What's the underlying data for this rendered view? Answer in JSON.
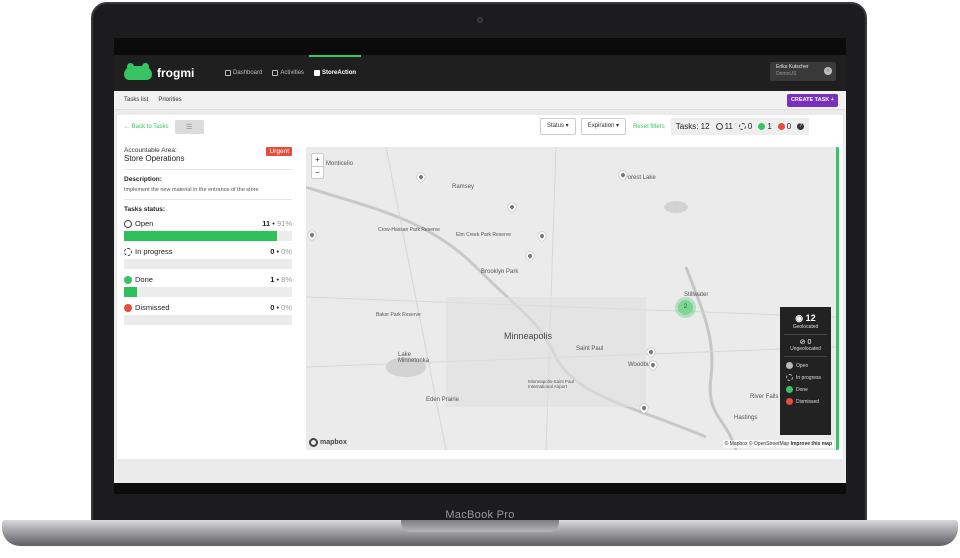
{
  "device": {
    "brand": "MacBook Pro"
  },
  "app": {
    "logo_text": "frogmi",
    "nav": [
      {
        "label": "Dashboard",
        "icon": "chart-icon"
      },
      {
        "label": "Activities",
        "icon": "clipboard-icon"
      },
      {
        "label": "StoreAction",
        "icon": "store-icon",
        "active": true
      }
    ],
    "user": {
      "name": "Erika Kutscher",
      "org": "DemoUS"
    },
    "subnav": {
      "tabs": [
        "Tasks list",
        "Priorities"
      ],
      "create_label": "CREATE TASK +"
    }
  },
  "toolbar": {
    "back_label": "Back to Tasks",
    "filters": [
      "Status",
      "Expiration"
    ],
    "reset_label": "Reset filters",
    "tasks_label": "Tasks: 12",
    "counts": {
      "open": "11",
      "in_progress": "0",
      "done": "1",
      "dismissed": "0"
    }
  },
  "task": {
    "area_label": "Accountable Area:",
    "area_name": "Store Operations",
    "priority": "Urgent",
    "description_title": "Description:",
    "description": "Implement the new material in the entrance of the store",
    "status_title": "Tasks status:",
    "statuses": [
      {
        "label": "Open",
        "count": "11",
        "pct": "91%",
        "fill": 0.91,
        "color": "#2ec05a"
      },
      {
        "label": "In progress",
        "count": "0",
        "pct": "0%",
        "fill": 0,
        "color": "#2ec05a"
      },
      {
        "label": "Done",
        "count": "1",
        "pct": "8%",
        "fill": 0.08,
        "color": "#2ec05a"
      },
      {
        "label": "Dismissed",
        "count": "0",
        "pct": "0%",
        "fill": 0,
        "color": "#2ec05a"
      }
    ]
  },
  "map": {
    "labels": [
      "Monticello",
      "Forest Lake",
      "Ramsey",
      "Crow-Hassan Park Reserve",
      "Elm Creek Park Reserve",
      "Brooklyn Park",
      "Stillwater",
      "Baker Park Reserve",
      "Minneapolis",
      "Saint Paul",
      "Lake Minnetonka",
      "Woodbury",
      "Eden Prairie",
      "Minneapolis-Saint Paul International Airport",
      "River Falls",
      "Hastings"
    ],
    "cluster_count": "2",
    "attribution": "© Mapbox © OpenStreetMap",
    "improve": "Improve this map",
    "mapbox_label": "mapbox",
    "legend": {
      "geolocated_count": "12",
      "geolocated_label": "Geolocated",
      "ungeolocated_count": "0",
      "ungeolocated_label": "Ungeolocated",
      "items": [
        "Open",
        "In progress",
        "Done",
        "Dismissed"
      ]
    }
  },
  "colors": {
    "accent": "#39c463",
    "create": "#7b2fbe",
    "urgent": "#e74c3c"
  }
}
